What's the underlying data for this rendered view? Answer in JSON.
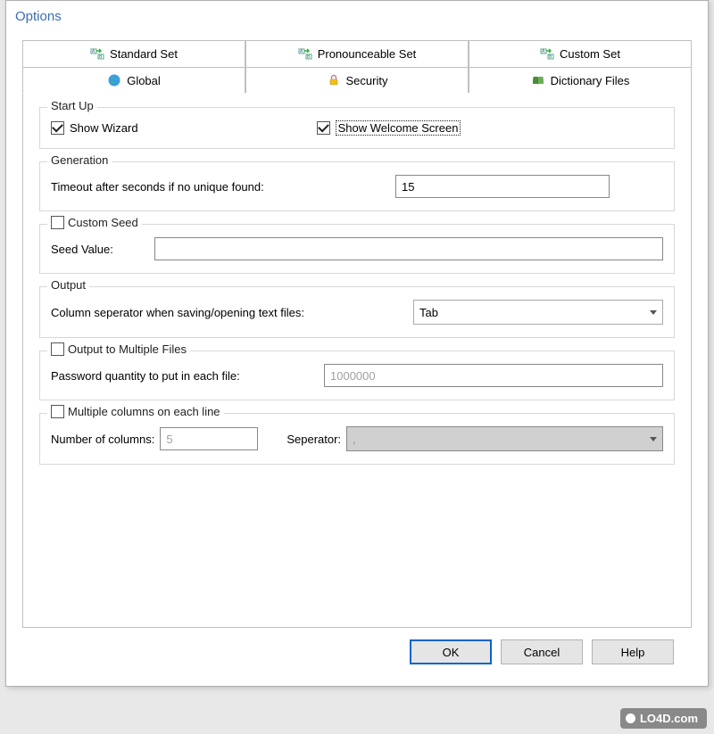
{
  "window": {
    "title": "Options"
  },
  "tabs": {
    "top": [
      {
        "label": "Standard Set"
      },
      {
        "label": "Pronounceable Set"
      },
      {
        "label": "Custom Set"
      }
    ],
    "bottom": [
      {
        "label": "Global",
        "active": true
      },
      {
        "label": "Security"
      },
      {
        "label": "Dictionary Files"
      }
    ]
  },
  "startup": {
    "legend": "Start Up",
    "show_wizard_label": "Show Wizard",
    "show_wizard_checked": true,
    "show_welcome_label": "Show Welcome Screen",
    "show_welcome_checked": true
  },
  "generation": {
    "legend": "Generation",
    "timeout_label": "Timeout after seconds if no unique found:",
    "timeout_value": "15"
  },
  "custom_seed": {
    "legend_check_label": "Custom Seed",
    "legend_checked": false,
    "seed_label": "Seed Value:",
    "seed_value": ""
  },
  "output": {
    "legend": "Output",
    "separator_label": "Column seperator when saving/opening text files:",
    "separator_value": "Tab"
  },
  "multifile": {
    "legend_check_label": "Output to Multiple Files",
    "legend_checked": false,
    "qty_label": "Password quantity to put in each file:",
    "qty_value": "1000000"
  },
  "multicol": {
    "legend_check_label": "Multiple columns on each line",
    "legend_checked": false,
    "numcols_label": "Number of columns:",
    "numcols_value": "5",
    "sep_label": "Seperator:",
    "sep_value": ","
  },
  "buttons": {
    "ok": "OK",
    "cancel": "Cancel",
    "help": "Help"
  },
  "watermark": "LO4D.com"
}
